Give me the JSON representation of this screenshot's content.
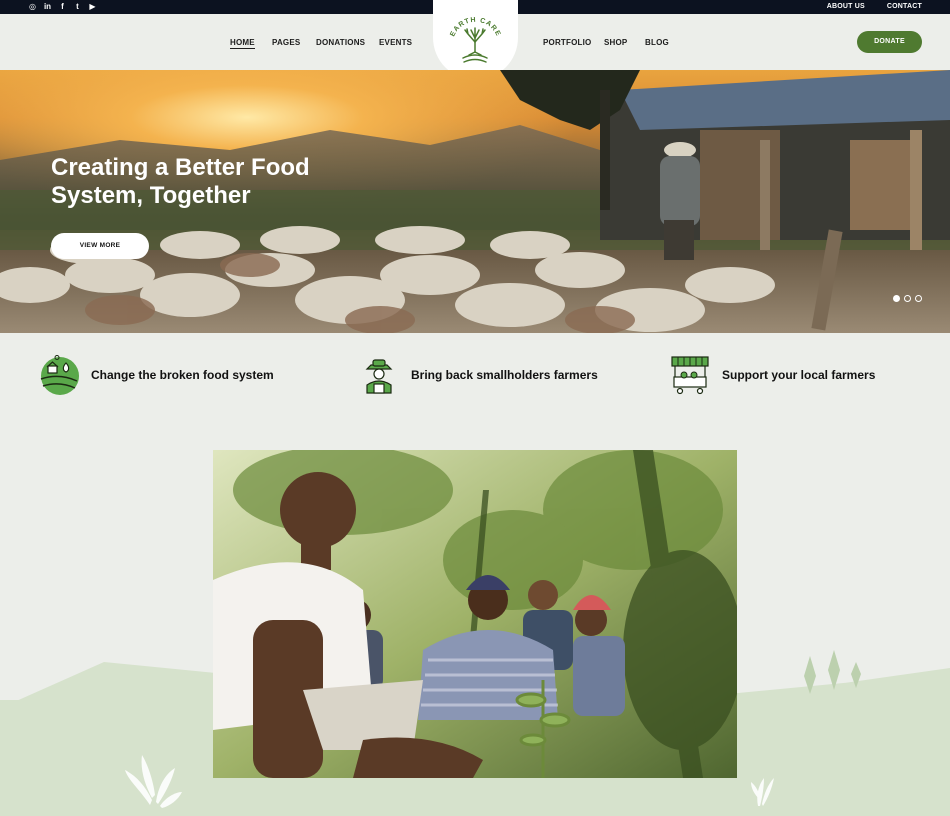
{
  "social": [
    "instagram-icon",
    "linkedin-icon",
    "facebook-icon",
    "twitter-icon",
    "youtube-icon"
  ],
  "toplinks": [
    "ABOUT US",
    "CONTACT"
  ],
  "nav": {
    "home": "HOME",
    "pages": "PAGES",
    "donations": "DONATIONS",
    "events": "EVENTS",
    "portfolio": "PORTFOLIO",
    "shop": "SHOP",
    "blog": "BLOG"
  },
  "logo": {
    "text": "EARTH CARE"
  },
  "donate_label": "DONATE",
  "hero": {
    "title": "Creating a Better Food System, Together",
    "button": "VIEW MORE",
    "slides": 3,
    "active_slide": 1
  },
  "features": [
    {
      "icon": "farm-fields-icon",
      "text": "Change the broken food system"
    },
    {
      "icon": "farmer-icon",
      "text": "Bring back smallholders farmers"
    },
    {
      "icon": "market-stall-icon",
      "text": "Support your local farmers"
    }
  ],
  "colors": {
    "accent": "#4f7a30",
    "icon_green": "#5aa84a",
    "topbar": "#0c1220",
    "background": "#eceeea",
    "ground": "#d6e2cc"
  }
}
